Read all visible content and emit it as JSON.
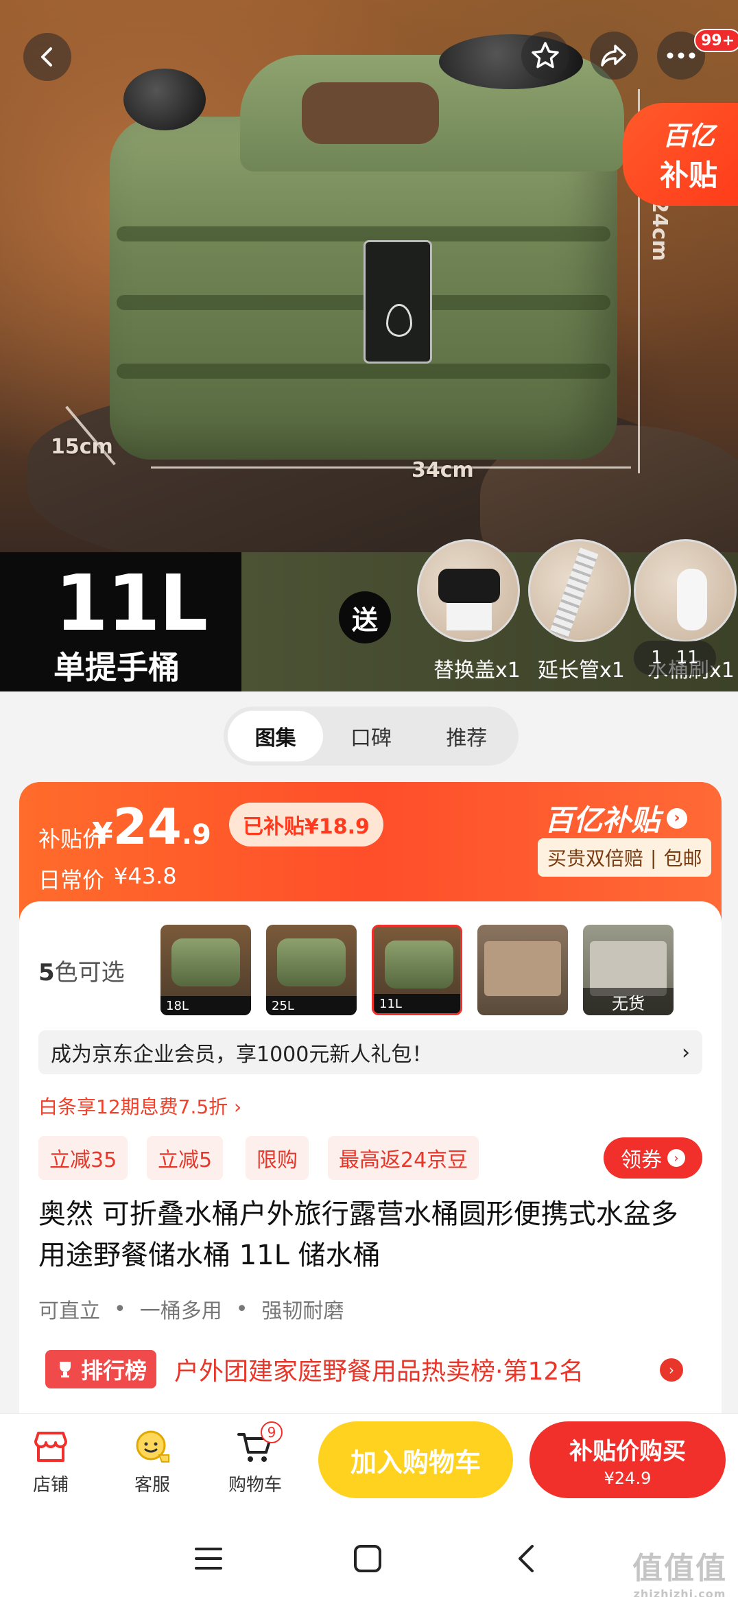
{
  "hero": {
    "dimensions": {
      "depth": "15cm",
      "width": "34cm",
      "height": "24cm"
    },
    "nav": {
      "more_badge": "99+"
    },
    "subsidy_tag": {
      "line1": "百亿",
      "line2": "补贴"
    },
    "capacity": "11L",
    "bucket_type": "单提手桶",
    "gift_badge": "送",
    "gifts": [
      {
        "label": "替换盖x1"
      },
      {
        "label": "延长管x1"
      },
      {
        "label": "水桶刷x1"
      }
    ],
    "image_index": "1",
    "image_total": "11"
  },
  "tabs": [
    {
      "label": "图集",
      "active": true
    },
    {
      "label": "口碑",
      "active": false
    },
    {
      "label": "推荐",
      "active": false
    }
  ],
  "price": {
    "subsidy_label": "补贴价",
    "currency": "¥",
    "integer": "24",
    "decimal": ".9",
    "subsidized_amount": "已补贴¥18.9",
    "regular_label": "日常价",
    "regular_price": "¥43.8",
    "brand": "百亿补贴",
    "brand_arrow": "›",
    "guarantee_1": "买贵双倍赔",
    "guarantee_sep": "|",
    "guarantee_2": "包邮"
  },
  "variants": {
    "label_num": "5",
    "label_text": "色可选",
    "items": [
      {
        "tag": "18L"
      },
      {
        "tag": "25L"
      },
      {
        "tag": "11L"
      },
      {
        "tag": ""
      },
      {
        "tag": "无货"
      }
    ]
  },
  "promo_banner": {
    "text": "成为京东企业会员，享1000元新人礼包！",
    "arrow": "›"
  },
  "baitiao": "白条享12期息费7.5折 ›",
  "coupons": [
    "立减35",
    "立减5",
    "限购",
    "最高返24京豆"
  ],
  "claim_button": {
    "label": "领券",
    "arrow": "›"
  },
  "product_title": "奥然 可折叠水桶户外旅行露营水桶圆形便携式水盆多用途野餐储水桶 11L 储水桶",
  "features": [
    "可直立",
    "一桶多用",
    "强韧耐磨"
  ],
  "feature_sep": "•",
  "ranking": {
    "badge": "排行榜",
    "text": "户外团建家庭野餐用品热卖榜·第12名",
    "arrow": "›"
  },
  "action_bar": {
    "shop": "店铺",
    "service": "客服",
    "cart": "购物车",
    "cart_count": "9",
    "add_to_cart": "加入购物车",
    "buy_now": "补贴价购买",
    "buy_now_price": "¥24.9"
  },
  "watermark": {
    "main": "值值值",
    "sub": "zhizhizhi.com"
  },
  "colors": {
    "accent": "#f2302b",
    "subsidy_orange": "#ff4e2a",
    "cart_yellow": "#ffd21f"
  }
}
